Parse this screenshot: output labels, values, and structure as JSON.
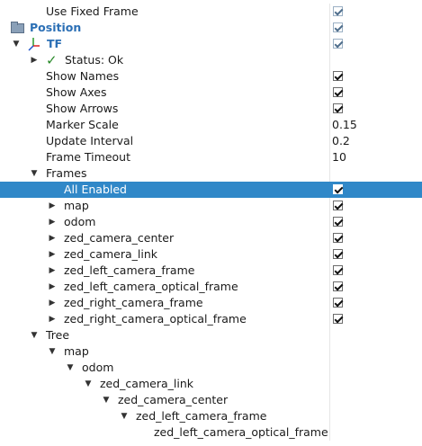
{
  "rows": {
    "use_fixed_frame": {
      "label": "Use Fixed Frame",
      "checked": true
    },
    "position": {
      "label": "Position",
      "checked": true
    },
    "tf": {
      "label": "TF",
      "checked": true
    },
    "status": {
      "label": "Status: Ok"
    },
    "show_names": {
      "label": "Show Names",
      "checked": true
    },
    "show_axes": {
      "label": "Show Axes",
      "checked": true
    },
    "show_arrows": {
      "label": "Show Arrows",
      "checked": true
    },
    "marker_scale": {
      "label": "Marker Scale",
      "value": "0.15"
    },
    "update_interval": {
      "label": "Update Interval",
      "value": "0.2"
    },
    "frame_timeout": {
      "label": "Frame Timeout",
      "value": "10"
    },
    "frames": {
      "label": "Frames"
    },
    "all_enabled": {
      "label": "All Enabled",
      "checked": true
    },
    "frame_items": [
      {
        "label": "map",
        "checked": true
      },
      {
        "label": "odom",
        "checked": true
      },
      {
        "label": "zed_camera_center",
        "checked": true
      },
      {
        "label": "zed_camera_link",
        "checked": true
      },
      {
        "label": "zed_left_camera_frame",
        "checked": true
      },
      {
        "label": "zed_left_camera_optical_frame",
        "checked": true
      },
      {
        "label": "zed_right_camera_frame",
        "checked": true
      },
      {
        "label": "zed_right_camera_optical_frame",
        "checked": true
      }
    ],
    "tree": {
      "label": "Tree"
    },
    "tree_items": [
      {
        "label": "map"
      },
      {
        "label": "odom"
      },
      {
        "label": "zed_camera_link"
      },
      {
        "label": "zed_camera_center"
      },
      {
        "label": "zed_left_camera_frame"
      },
      {
        "label": "zed_left_camera_optical_frame"
      }
    ]
  },
  "colors": {
    "selection": "#3088c8",
    "header_blue": "#2b6fb5",
    "status_green": "#2a8a2a"
  },
  "icons": {
    "expanded": "triangle-down",
    "collapsed": "triangle-right",
    "status": "checkmark-icon",
    "display_folder": "folder-icon",
    "tf_display": "axes-icon"
  }
}
